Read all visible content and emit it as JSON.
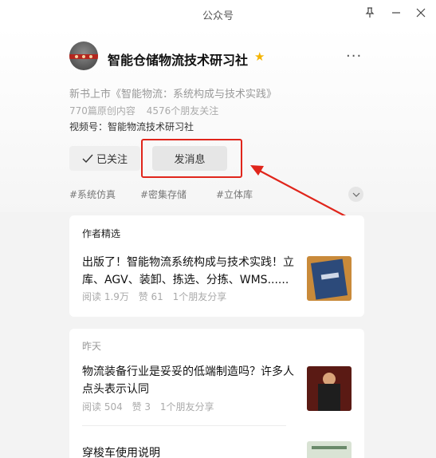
{
  "window": {
    "title": "公众号"
  },
  "account": {
    "name": "智能仓储物流技术研习社",
    "description": "新书上市《智能物流：系统构成与技术实践》",
    "original_count": "770篇原创内容",
    "friends_follow": "4576个朋友关注",
    "video_channel": "视频号：智能物流技术研习社"
  },
  "actions": {
    "follow_label": "已关注",
    "message_label": "发消息"
  },
  "tags": [
    "#系统仿真",
    "#密集存储",
    "#立体库"
  ],
  "featured": {
    "label": "作者精选",
    "article": {
      "title": "出版了！智能物流系统构成与技术实践！立库、AGV、装卸、拣选、分拣、WMS......",
      "reads": "阅读 1.9万",
      "likes": "赞 61",
      "shares": "1个朋友分享"
    }
  },
  "yesterday": {
    "label": "昨天",
    "articles": [
      {
        "title": "物流装备行业是妥妥的低端制造吗？许多人点头表示认同",
        "reads": "阅读 504",
        "likes": "赞 3",
        "shares": "1个朋友分享"
      },
      {
        "title": "穿梭车使用说明"
      }
    ]
  },
  "colors": {
    "highlight": "#e0251b",
    "star": "#f5b400"
  }
}
